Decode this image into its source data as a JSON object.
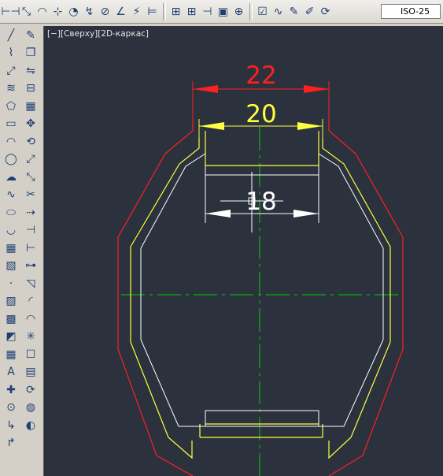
{
  "toolbar_top": {
    "buttons": [
      {
        "icon": "linear-dimension-icon",
        "glyph": "⊢⊣"
      },
      {
        "icon": "aligned-dimension-icon",
        "glyph": "⤡"
      },
      {
        "icon": "arc-length-icon",
        "glyph": "◠"
      },
      {
        "icon": "ordinate-dimension-icon",
        "glyph": "⊹"
      },
      {
        "icon": "radius-dimension-icon",
        "glyph": "◔"
      },
      {
        "icon": "jogged-dimension-icon",
        "glyph": "↯"
      },
      {
        "icon": "diameter-dimension-icon",
        "glyph": "⊘"
      },
      {
        "icon": "angular-dimension-icon",
        "glyph": "∠"
      },
      {
        "icon": "quick-dimension-icon",
        "glyph": "⚡"
      },
      {
        "icon": "baseline-dimension-icon",
        "glyph": "⊨"
      },
      {
        "icon": "continue-dimension-icon",
        "glyph": "⊞"
      },
      {
        "icon": "dimension-space-icon",
        "glyph": "⊞"
      },
      {
        "icon": "dimension-break-icon",
        "glyph": "⊣"
      },
      {
        "icon": "tolerance-icon",
        "glyph": "▣"
      },
      {
        "icon": "center-mark-icon",
        "glyph": "⊕"
      },
      {
        "icon": "inspection-icon",
        "glyph": "☑"
      },
      {
        "icon": "jogged-linear-icon",
        "glyph": "∿"
      },
      {
        "icon": "dimension-edit-icon",
        "glyph": "✎"
      },
      {
        "icon": "dimension-text-edit-icon",
        "glyph": "✐"
      },
      {
        "icon": "dimension-update-icon",
        "glyph": "⟳"
      }
    ],
    "dimstyle": "ISO-25"
  },
  "left_col_1": [
    "line-icon",
    "polyline-icon",
    "construction-line-icon",
    "multiline-icon",
    "polygon-icon",
    "rectangle-icon",
    "arc-icon",
    "circle-icon",
    "revision-cloud-icon",
    "spline-icon",
    "ellipse-icon",
    "ellipse-arc-icon",
    "insert-block-icon",
    "make-block-icon",
    "point-icon",
    "hatch-icon",
    "gradient-icon",
    "region-icon",
    "table-icon",
    "multiline-text-icon",
    "add-selected-icon",
    "snap-icon",
    "snap-from-icon",
    "snap-endpoint-icon"
  ],
  "left_col_2": [
    "erase-icon",
    "copy-icon",
    "mirror-icon",
    "offset-icon",
    "array-icon",
    "move-icon",
    "rotate-icon",
    "scale-icon",
    "stretch-icon",
    "trim-icon",
    "extend-icon",
    "break-point-icon",
    "break-icon",
    "join-icon",
    "chamfer-icon",
    "fillet-icon",
    "blend-icon",
    "explode-icon",
    "3d-icon",
    "dim-icon",
    "orbit-icon",
    "render-icon",
    "material-icon"
  ],
  "viewport": {
    "label": "[−][Сверху][2D-каркас]"
  },
  "drawing": {
    "dimension_labels": {
      "outer": "22",
      "middle": "20",
      "inner": "18"
    },
    "colors": {
      "outer": "#ff2020",
      "middle": "#ffff40",
      "inner": "#ffffff",
      "centerline": "#00d000",
      "background": "#2b313d"
    }
  }
}
